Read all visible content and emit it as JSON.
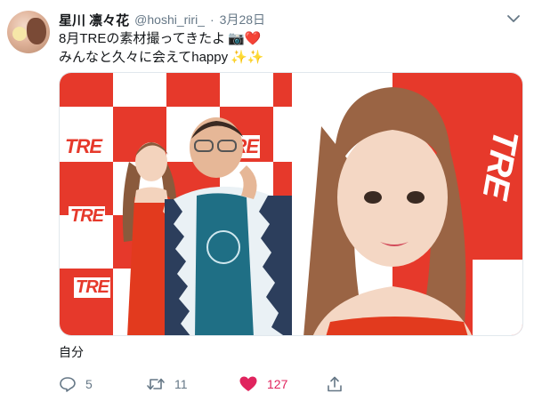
{
  "user": {
    "display_name": "星川 凛々花",
    "handle": "@hoshi_riri_",
    "separator": "·",
    "date": "3月28日"
  },
  "tweet": {
    "line1": "8月TREの素材撮ってきたよ",
    "line1_emoji": "📷❤️",
    "line2": "みんなと久々に会えてhappy",
    "line2_emoji": "✨✨"
  },
  "media": {
    "logo_text": "TRE",
    "accent_color": "#e6392b"
  },
  "footer": {
    "tag_label": "自分"
  },
  "actions": {
    "reply_count": "5",
    "retweet_count": "11",
    "like_count": "127",
    "like_color": "#e0245e"
  },
  "icons": [
    "chevron-down-icon",
    "reply-icon",
    "retweet-icon",
    "heart-icon",
    "share-icon",
    "camera-icon"
  ]
}
